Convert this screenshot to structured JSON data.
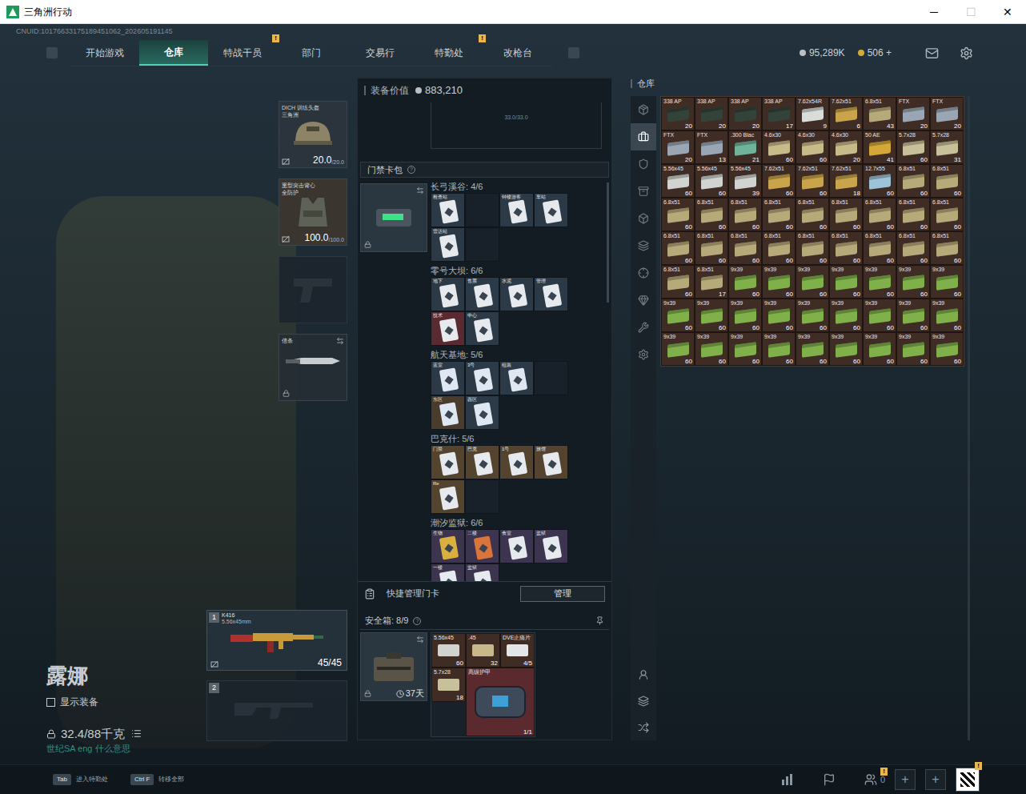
{
  "window": {
    "title": "三角洲行动",
    "controls": [
      {
        "glyph": "─",
        "disabled": false
      },
      {
        "glyph": "☐",
        "disabled": true
      },
      {
        "glyph": "✕",
        "disabled": false
      }
    ]
  },
  "uid": "CNUID:10176633175189451062_202605191145",
  "nav": {
    "items": [
      {
        "label": "开始游戏",
        "selected": false,
        "badge": ""
      },
      {
        "label": "仓库",
        "selected": true,
        "badge": ""
      },
      {
        "label": "特战干员",
        "selected": false,
        "badge": "!"
      },
      {
        "label": "部门",
        "selected": false,
        "badge": ""
      },
      {
        "label": "交易行",
        "selected": false,
        "badge": ""
      },
      {
        "label": "特勤处",
        "selected": false,
        "badge": "!"
      },
      {
        "label": "改枪台",
        "selected": false,
        "badge": ""
      }
    ],
    "coins": "95,289K",
    "tickets": "506 +"
  },
  "character": {
    "name": "露娜",
    "show_equipment": {
      "label": "显示装备",
      "checked": false
    },
    "weight": "32.4/88千克",
    "hint": "世纪SA eng 什么意思"
  },
  "equipment": [
    {
      "kind": "helmet",
      "label": "DICH 训练头盔",
      "sublabel": "三角洲",
      "value": "20.0",
      "max": "/20.0"
    },
    {
      "kind": "armor",
      "label": "重型突击背心",
      "sublabel": "全防护",
      "value": "100.0",
      "max": "/100.0"
    },
    {
      "kind": "pistol"
    },
    {
      "kind": "melee",
      "label": "信条"
    }
  ],
  "weapons": [
    {
      "slot": "1",
      "equipped": true,
      "name": "K416",
      "caliber": "5.56x45mm",
      "ammo": "45/45"
    },
    {
      "slot": "2",
      "equipped": false
    }
  ],
  "loadout": {
    "value_label": "装备价值",
    "value": "883,210",
    "capacity": "33.0/33.0"
  },
  "keycard_pack": {
    "title": "门禁卡包",
    "help": "?",
    "groups": [
      {
        "name": "长弓溪谷",
        "count": "4/6",
        "slots": [
          {
            "label": "检查站",
            "filled": true,
            "color": "#2c3a48",
            "card": "#e6eaee"
          },
          {
            "label": "",
            "filled": false,
            "color": "#182129",
            "card": "#182129"
          },
          {
            "label": "钟楼游客",
            "filled": true,
            "color": "#2c3a48",
            "card": "#e6eaee"
          },
          {
            "label": "车站",
            "filled": true,
            "color": "#2c3a48",
            "card": "#e6eaee"
          },
          {
            "label": "雷达站",
            "filled": true,
            "color": "#2c3a48",
            "card": "#e6eaee"
          },
          {
            "label": "",
            "filled": false,
            "color": "#182129",
            "card": "#182129"
          }
        ]
      },
      {
        "name": "零号大坝",
        "count": "6/6",
        "slots": [
          {
            "label": "地下",
            "filled": true,
            "color": "#2c3a48",
            "card": "#e6eaee"
          },
          {
            "label": "售票",
            "filled": true,
            "color": "#2c3a48",
            "card": "#e6eaee"
          },
          {
            "label": "水泥",
            "filled": true,
            "color": "#2c3a48",
            "card": "#e6eaee"
          },
          {
            "label": "管理",
            "filled": true,
            "color": "#2c3a48",
            "card": "#e6eaee"
          },
          {
            "label": "技术",
            "filled": true,
            "color": "#5a2a32",
            "card": "#e6eaee"
          },
          {
            "label": "中心",
            "filled": true,
            "color": "#2c3a48",
            "card": "#e6eaee"
          }
        ]
      },
      {
        "name": "航天基地",
        "count": "5/6",
        "slots": [
          {
            "label": "蓝室",
            "filled": true,
            "color": "#2c3a48",
            "card": "#dfe8f2"
          },
          {
            "label": "3号",
            "filled": true,
            "color": "#2c3a48",
            "card": "#dfe8f2"
          },
          {
            "label": "组装",
            "filled": true,
            "color": "#2c3a48",
            "card": "#dfe8f2"
          },
          {
            "label": "",
            "filled": false,
            "color": "#182129",
            "card": "#182129"
          },
          {
            "label": "东区",
            "filled": true,
            "color": "#4a3c2c",
            "card": "#dfe8f2"
          },
          {
            "label": "西区",
            "filled": true,
            "color": "#2c3a48",
            "card": "#dfe8f2"
          }
        ]
      },
      {
        "name": "巴克什",
        "count": "5/6",
        "slots": [
          {
            "label": "门禁",
            "filled": true,
            "color": "#54432e",
            "card": "#e6eaee"
          },
          {
            "label": "巴克",
            "filled": true,
            "color": "#54432e",
            "card": "#e6eaee"
          },
          {
            "label": "1号",
            "filled": true,
            "color": "#54432e",
            "card": "#e6eaee"
          },
          {
            "label": "旅馆",
            "filled": true,
            "color": "#54432e",
            "card": "#e6eaee"
          },
          {
            "label": "Re",
            "filled": true,
            "color": "#54432e",
            "card": "#e6eaee"
          },
          {
            "label": "",
            "filled": false,
            "color": "#182129",
            "card": "#182129"
          }
        ]
      },
      {
        "name": "潮汐监狱",
        "count": "6/6",
        "slots": [
          {
            "label": "生物",
            "filled": true,
            "color": "#3d3450",
            "card": "#d9b040"
          },
          {
            "label": "二楼",
            "filled": true,
            "color": "#3d3450",
            "card": "#d9743a"
          },
          {
            "label": "食堂",
            "filled": true,
            "color": "#3d3450",
            "card": "#e6eaee"
          },
          {
            "label": "监狱",
            "filled": true,
            "color": "#3d3450",
            "card": "#e6eaee"
          },
          {
            "label": "一楼",
            "filled": true,
            "color": "#3d3450",
            "card": "#e6eaee"
          },
          {
            "label": "监狱",
            "filled": true,
            "color": "#3d3450",
            "card": "#e6eaee"
          }
        ]
      }
    ]
  },
  "quick_manage": {
    "label": "快捷管理门卡",
    "button": "管理"
  },
  "safe_box": {
    "title": "安全箱: 8/9",
    "help": "?",
    "days": "37天",
    "items": [
      {
        "label": "5.56x45",
        "count": "60",
        "color": "#d0d3d0",
        "big": false
      },
      {
        "label": ".45",
        "count": "32",
        "color": "#c9b98a",
        "big": false
      },
      {
        "label": "DVE止痛片",
        "count": "4/5",
        "color": "#e3e6e8",
        "big": false
      },
      {
        "label": "5.7x28",
        "count": "18",
        "color": "#c8c09a",
        "big": false
      },
      {
        "label": "高级护甲",
        "count": "1/1",
        "color": "#3e4a5a",
        "big": true
      }
    ]
  },
  "warehouse": {
    "title": "仓库",
    "tabs": [
      {
        "selected": false
      },
      {
        "selected": true
      },
      {
        "selected": false
      },
      {
        "selected": false
      },
      {
        "selected": false
      },
      {
        "selected": false
      },
      {
        "selected": false
      },
      {
        "selected": false
      },
      {
        "selected": false
      },
      {
        "selected": false
      }
    ],
    "items": [
      {
        "label": "338 AP",
        "count": "20",
        "color": "#34433a"
      },
      {
        "label": "338 AP",
        "count": "20",
        "color": "#34433a"
      },
      {
        "label": "338 AP",
        "count": "20",
        "color": "#34433a"
      },
      {
        "label": "338 AP",
        "count": "17",
        "color": "#34433a"
      },
      {
        "label": "7.62x54R",
        "count": "9",
        "color": "#d9dcd8"
      },
      {
        "label": "7.62x51",
        "count": "6",
        "color": "#c9a44a"
      },
      {
        "label": "6.8x51",
        "count": "43",
        "color": "#b7aa7a"
      },
      {
        "label": "FTX",
        "count": "20",
        "color": "#9aa6b4"
      },
      {
        "label": "FTX",
        "count": "20",
        "color": "#9aa6b4"
      },
      {
        "label": "FTX",
        "count": "20",
        "color": "#9aa6b4"
      },
      {
        "label": "FTX",
        "count": "13",
        "color": "#9aa6b4"
      },
      {
        "label": ".300 Blac",
        "count": "21",
        "color": "#6fb39a"
      },
      {
        "label": "4.6x30",
        "count": "60",
        "color": "#c8bb8a"
      },
      {
        "label": "4.6x30",
        "count": "60",
        "color": "#c8bb8a"
      },
      {
        "label": "4.6x30",
        "count": "20",
        "color": "#c8bb8a"
      },
      {
        "label": "50 AE",
        "count": "41",
        "color": "#d4a838"
      },
      {
        "label": "5.7x28",
        "count": "60",
        "color": "#c8c09a"
      },
      {
        "label": "5.7x28",
        "count": "31",
        "color": "#c8c09a"
      },
      {
        "label": "5.56x45",
        "count": "60",
        "color": "#d0d3d0"
      },
      {
        "label": "5.56x45",
        "count": "60",
        "color": "#d0d3d0"
      },
      {
        "label": "5.56x45",
        "count": "39",
        "color": "#d0d3d0"
      },
      {
        "label": "7.62x51",
        "count": "60",
        "color": "#c9a44a"
      },
      {
        "label": "7.62x51",
        "count": "60",
        "color": "#c9a44a"
      },
      {
        "label": "7.62x51",
        "count": "18",
        "color": "#c9a44a"
      },
      {
        "label": "12.7x55",
        "count": "60",
        "color": "#9cc3d8"
      },
      {
        "label": "6.8x51",
        "count": "60",
        "color": "#b7aa7a"
      },
      {
        "label": "6.8x51",
        "count": "60",
        "color": "#b7aa7a"
      },
      {
        "label": "6.8x51",
        "count": "60",
        "color": "#b7aa7a"
      },
      {
        "label": "6.8x51",
        "count": "60",
        "color": "#b7aa7a"
      },
      {
        "label": "6.8x51",
        "count": "60",
        "color": "#b7aa7a"
      },
      {
        "label": "6.8x51",
        "count": "60",
        "color": "#b7aa7a"
      },
      {
        "label": "6.8x51",
        "count": "60",
        "color": "#b7aa7a"
      },
      {
        "label": "6.8x51",
        "count": "60",
        "color": "#b7aa7a"
      },
      {
        "label": "6.8x51",
        "count": "60",
        "color": "#b7aa7a"
      },
      {
        "label": "6.8x51",
        "count": "60",
        "color": "#b7aa7a"
      },
      {
        "label": "6.8x51",
        "count": "60",
        "color": "#b7aa7a"
      },
      {
        "label": "6.8x51",
        "count": "60",
        "color": "#b7aa7a"
      },
      {
        "label": "6.8x51",
        "count": "60",
        "color": "#b7aa7a"
      },
      {
        "label": "6.8x51",
        "count": "60",
        "color": "#b7aa7a"
      },
      {
        "label": "6.8x51",
        "count": "60",
        "color": "#b7aa7a"
      },
      {
        "label": "6.8x51",
        "count": "60",
        "color": "#b7aa7a"
      },
      {
        "label": "6.8x51",
        "count": "60",
        "color": "#b7aa7a"
      },
      {
        "label": "6.8x51",
        "count": "60",
        "color": "#b7aa7a"
      },
      {
        "label": "6.8x51",
        "count": "60",
        "color": "#b7aa7a"
      },
      {
        "label": "6.8x51",
        "count": "60",
        "color": "#b7aa7a"
      },
      {
        "label": "6.8x51",
        "count": "60",
        "color": "#b7aa7a"
      },
      {
        "label": "6.8x51",
        "count": "17",
        "color": "#b7aa7a"
      },
      {
        "label": "9x39",
        "count": "60",
        "color": "#7fb04a"
      },
      {
        "label": "9x39",
        "count": "60",
        "color": "#7fb04a"
      },
      {
        "label": "9x39",
        "count": "60",
        "color": "#7fb04a"
      },
      {
        "label": "9x39",
        "count": "60",
        "color": "#7fb04a"
      },
      {
        "label": "9x39",
        "count": "60",
        "color": "#7fb04a"
      },
      {
        "label": "9x39",
        "count": "60",
        "color": "#7fb04a"
      },
      {
        "label": "9x39",
        "count": "60",
        "color": "#7fb04a"
      },
      {
        "label": "9x39",
        "count": "60",
        "color": "#7fb04a"
      },
      {
        "label": "9x39",
        "count": "60",
        "color": "#7fb04a"
      },
      {
        "label": "9x39",
        "count": "60",
        "color": "#7fb04a"
      },
      {
        "label": "9x39",
        "count": "60",
        "color": "#7fb04a"
      },
      {
        "label": "9x39",
        "count": "60",
        "color": "#7fb04a"
      },
      {
        "label": "9x39",
        "count": "60",
        "color": "#7fb04a"
      },
      {
        "label": "9x39",
        "count": "60",
        "color": "#7fb04a"
      },
      {
        "label": "9x39",
        "count": "60",
        "color": "#7fb04a"
      },
      {
        "label": "9x39",
        "count": "60",
        "color": "#7fb04a"
      },
      {
        "label": "9x39",
        "count": "60",
        "color": "#7fb04a"
      },
      {
        "label": "9x39",
        "count": "60",
        "color": "#7fb04a"
      },
      {
        "label": "9x39",
        "count": "60",
        "color": "#7fb04a"
      },
      {
        "label": "9x39",
        "count": "60",
        "color": "#7fb04a"
      },
      {
        "label": "9x39",
        "count": "60",
        "color": "#7fb04a"
      },
      {
        "label": "9x39",
        "count": "60",
        "color": "#7fb04a"
      },
      {
        "label": "9x39",
        "count": "60",
        "color": "#7fb04a"
      },
      {
        "label": "9x39",
        "count": "60",
        "color": "#7fb04a"
      },
      {
        "label": "9x39",
        "count": "60",
        "color": "#7fb04a"
      }
    ]
  },
  "bottom_bar": {
    "hints": [
      {
        "key": "Tab",
        "label": "进入特勤处"
      },
      {
        "key": "Ctrl F",
        "label": "转移全部"
      }
    ],
    "friends": "0",
    "friends_badge": "!",
    "slots": [
      "+",
      "+"
    ],
    "avatar_badge": "!"
  }
}
